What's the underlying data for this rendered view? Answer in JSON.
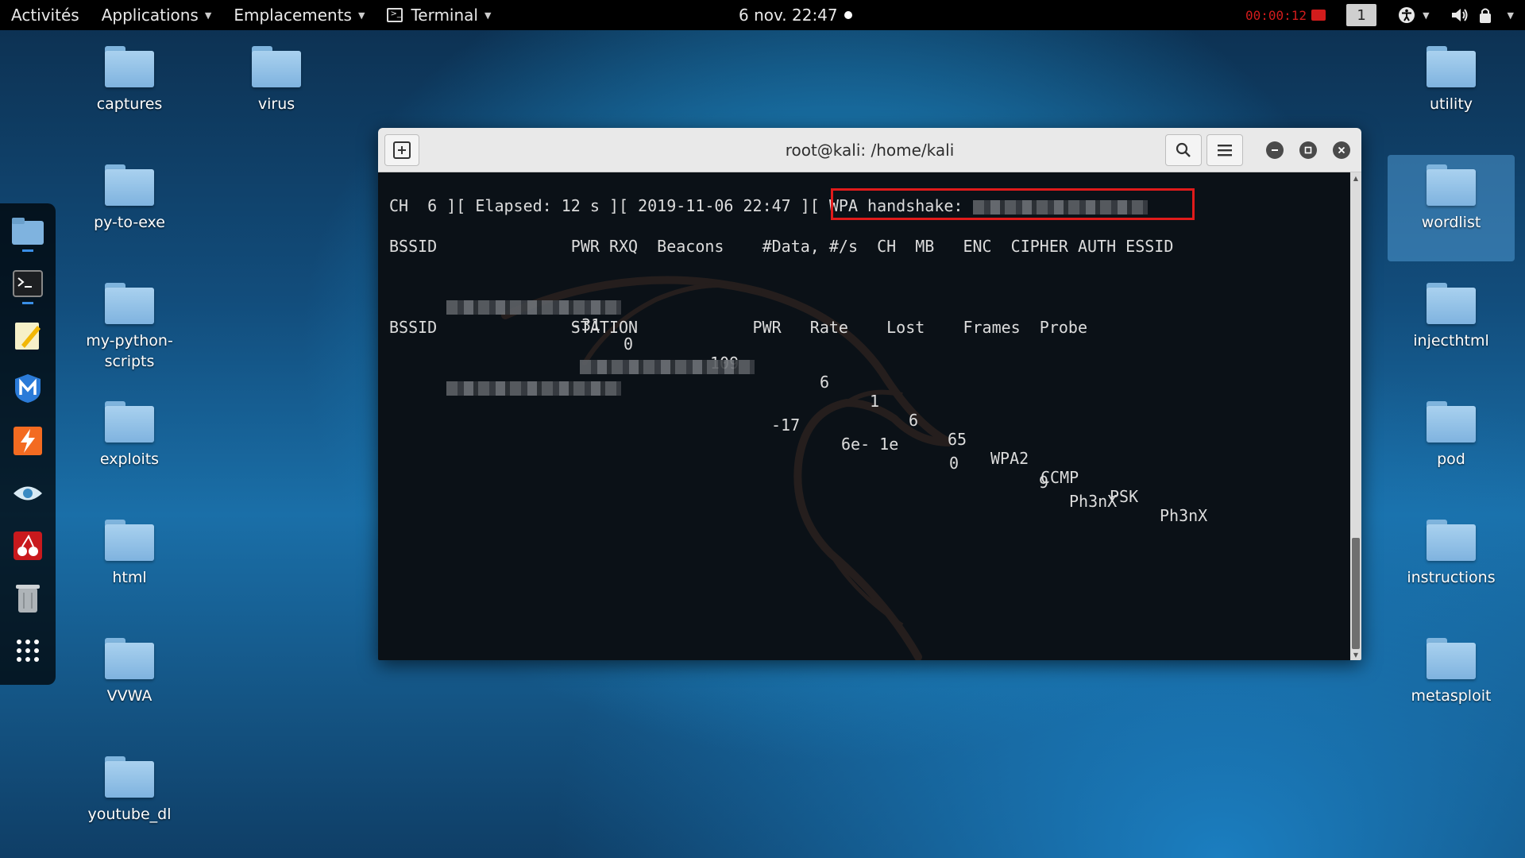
{
  "topbar": {
    "activities": "Activités",
    "applications": "Applications",
    "places": "Emplacements",
    "terminal_menu": "Terminal",
    "clock": "6 nov.  22:47",
    "recording_time": "00:00:12",
    "workspace": "1"
  },
  "desktop_left": [
    {
      "label": "captures"
    },
    {
      "label": "virus"
    },
    {
      "label": "py-to-exe"
    },
    {
      "label": "my-python-scripts"
    },
    {
      "label": "exploits"
    },
    {
      "label": "html"
    },
    {
      "label": "VVWA"
    },
    {
      "label": "youtube_dl"
    }
  ],
  "desktop_right": [
    {
      "label": "utility"
    },
    {
      "label": "wordlist"
    },
    {
      "label": "injecthtml"
    },
    {
      "label": "pod"
    },
    {
      "label": "instructions"
    },
    {
      "label": "metasploit"
    }
  ],
  "terminal": {
    "title": "root@kali: /home/kali",
    "status_line": "CH  6 ][ Elapsed: 12 s ][ 2019-11-06 22:47 ][ WPA handshake: ",
    "ap_header": "BSSID              PWR RXQ  Beacons    #Data, #/s  CH  MB   ENC  CIPHER AUTH ESSID",
    "ap_row": {
      "pwr": "-31",
      "rxq": "0",
      "beacons": "109",
      "data": "6",
      "per_s": "1",
      "ch": "6",
      "mb": "65",
      "enc": "WPA2",
      "cipher": "CCMP",
      "auth": "PSK",
      "essid": "Ph3nX"
    },
    "station_header": "BSSID              STATION            PWR   Rate    Lost    Frames  Probe",
    "station_row": {
      "pwr": "-17",
      "rate": "6e- 1e",
      "lost": "0",
      "frames": "9",
      "probe": "Ph3nX"
    }
  },
  "colors": {
    "highlight_box": "#e01b1b",
    "recording": "#d21c1c"
  }
}
